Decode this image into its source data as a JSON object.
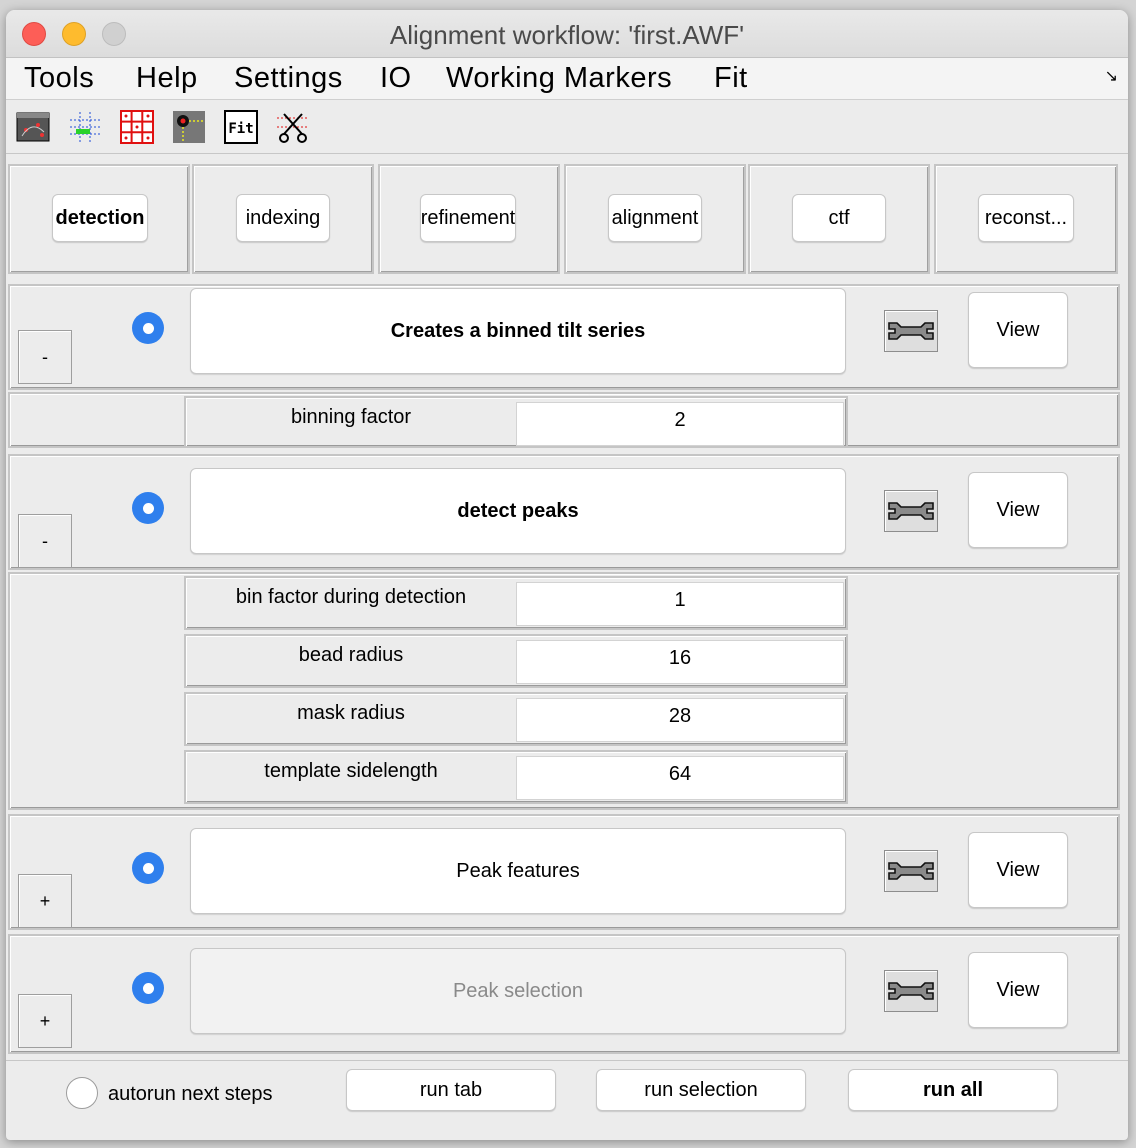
{
  "window": {
    "title": "Alignment workflow: 'first.AWF'"
  },
  "menu": [
    "Tools",
    "Help",
    "Settings",
    "IO",
    "Working Markers",
    "Fit"
  ],
  "menu_corner_glyph": "↘",
  "toolbar": {
    "icons": [
      "tilt-series-viewer-icon",
      "marker-tracking-icon",
      "grid-icon",
      "marker-position-icon",
      "fit-icon",
      "cut-markers-icon"
    ],
    "fit_icon_text": "Fit"
  },
  "tabs": [
    "detection",
    "indexing",
    "refinement",
    "alignment",
    "ctf",
    "reconst..."
  ],
  "steps": {
    "binned": {
      "label": "Creates a binned tilt series",
      "expander": "-",
      "view": "View",
      "params": {
        "binning_factor": {
          "label": "binning factor",
          "value": "2"
        }
      }
    },
    "detect": {
      "label": "detect peaks",
      "expander": "-",
      "view": "View",
      "params": {
        "bin_factor": {
          "label": "bin factor during detection",
          "value": "1"
        },
        "bead_radius": {
          "label": "bead radius",
          "value": "16"
        },
        "mask_radius": {
          "label": "mask radius",
          "value": "28"
        },
        "template_sidelength": {
          "label": "template sidelength",
          "value": "64"
        }
      }
    },
    "features": {
      "label": "Peak features",
      "expander": "+",
      "view": "View"
    },
    "selection": {
      "label": "Peak selection",
      "expander": "+",
      "view": "View",
      "disabled": true
    }
  },
  "bottom": {
    "autorun_label": "autorun next steps",
    "run_tab": "run tab",
    "run_selection": "run selection",
    "run_all": "run all"
  },
  "colors": {
    "radio_accent": "#2f7fed",
    "close": "#fd5e57",
    "minimize": "#febb2e"
  }
}
